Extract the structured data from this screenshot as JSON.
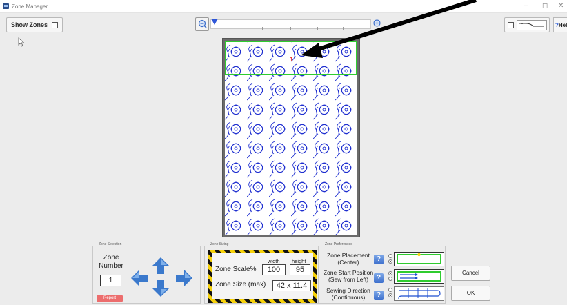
{
  "window": {
    "title": "Zone Manager",
    "controls": [
      "–",
      "◻",
      "✕"
    ]
  },
  "toolbar": {
    "show_zones_label": "Show Zones",
    "show_zones_checked": false,
    "zoom_level": 0.0,
    "help_label": "Help",
    "help_mark": "?"
  },
  "preview": {
    "selected_zone_marker": "1",
    "zone_color": "#2fcc2f",
    "pattern_color": "#1f2fd0",
    "frame_color": "#6b6b6b"
  },
  "zone_selection": {
    "group_title": "Zone Selection",
    "label_line1": "Zone",
    "label_line2": "Number",
    "zone_number": "1",
    "report_label": "Report"
  },
  "zone_sizing": {
    "group_title": "Zone Sizing",
    "scale_label": "Zone Scale%",
    "width_label": "width",
    "height_label": "height",
    "width_value": "100",
    "height_value": "95",
    "size_label": "Zone Size (max)",
    "size_value": "42 x 11.4"
  },
  "zone_preferences": {
    "group_title": "Zone Preferences",
    "placement_line1": "Zone Placement",
    "placement_line2": "(Center)",
    "start_line1": "Zone Start Position",
    "start_line2": "(Sew from Left)",
    "direction_line1": "Sewing Direction",
    "direction_line2": "(Continuous)",
    "help_mark": "?",
    "accent": "#2fcc2f"
  },
  "dialog_buttons": {
    "cancel": "Cancel",
    "ok": "OK"
  }
}
